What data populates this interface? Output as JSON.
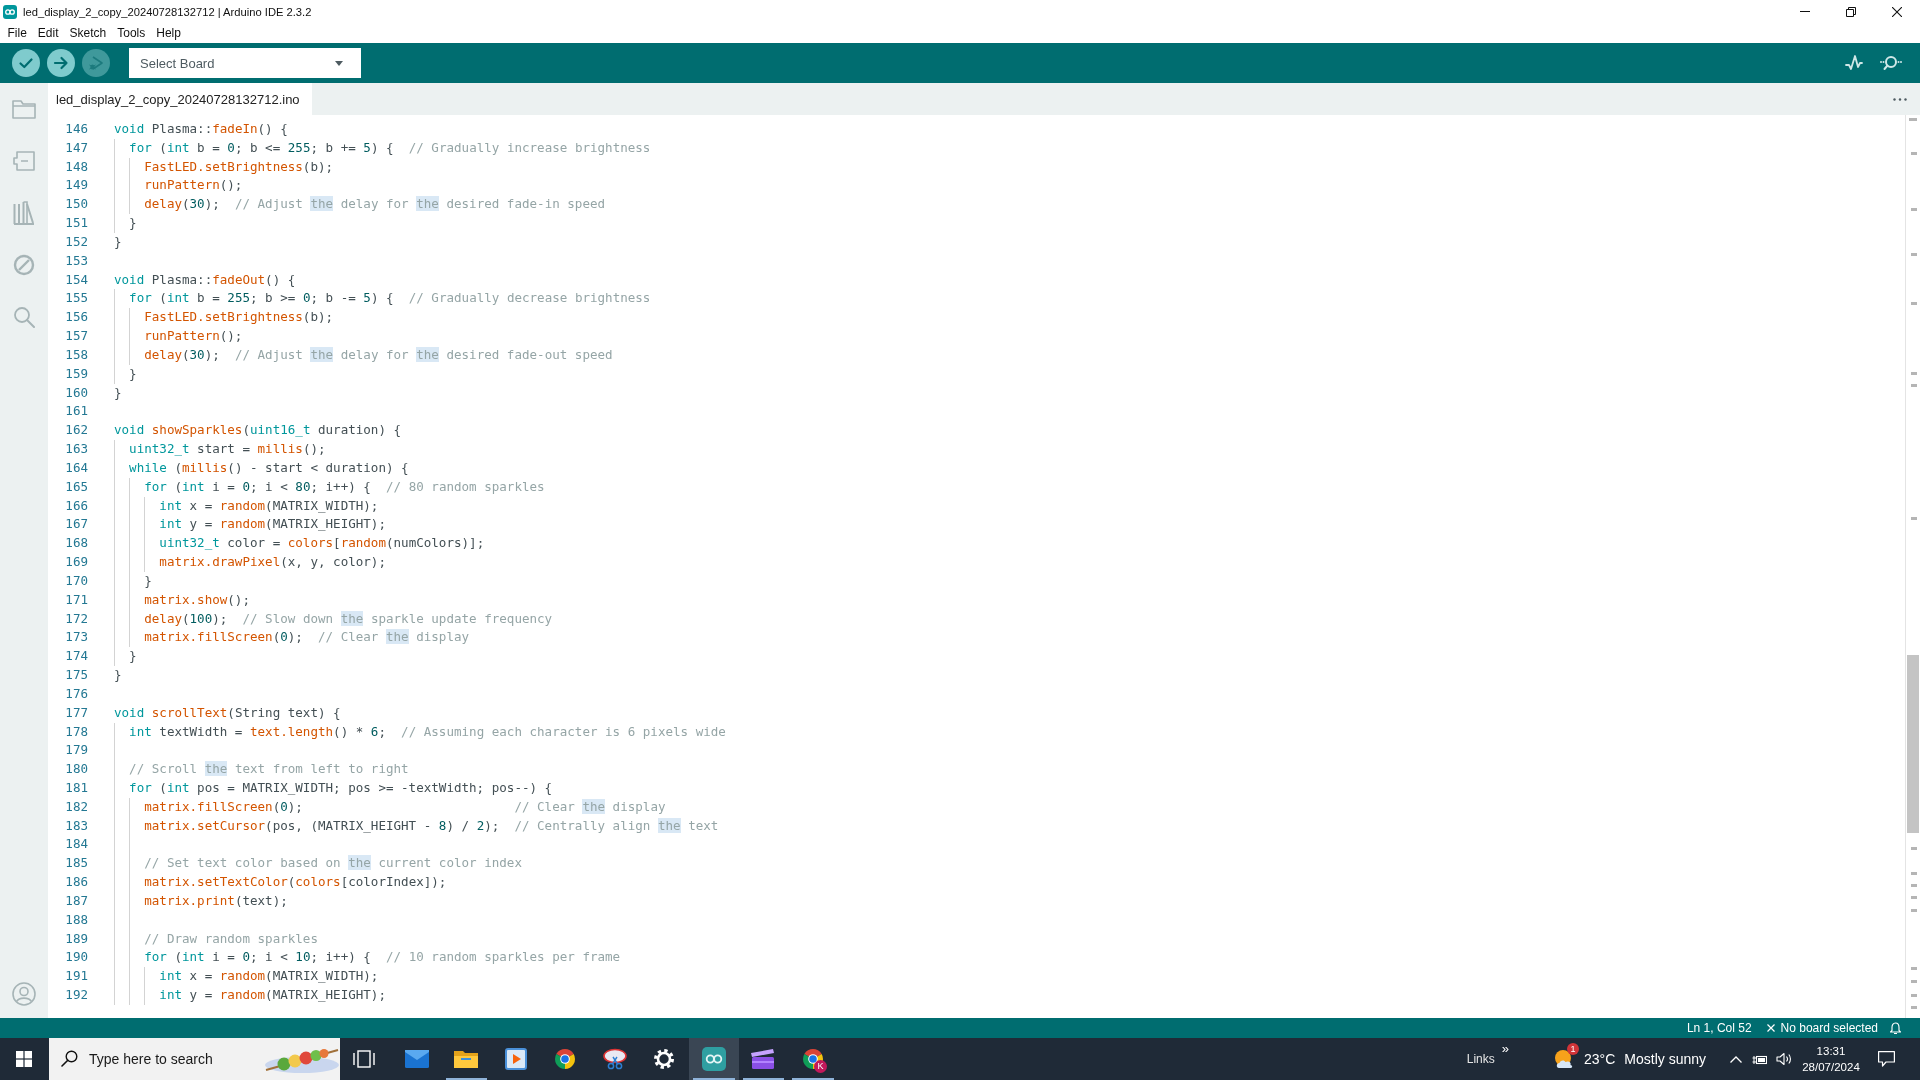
{
  "window": {
    "title": "led_display_2_copy_20240728132712 | Arduino IDE 2.3.2"
  },
  "menu": [
    "File",
    "Edit",
    "Sketch",
    "Tools",
    "Help"
  ],
  "toolbar": {
    "buttons": [
      {
        "kind": "verify",
        "disabled": false
      },
      {
        "kind": "upload",
        "disabled": false
      },
      {
        "kind": "debug",
        "disabled": true
      }
    ],
    "board_select": {
      "label": "Select Board"
    },
    "right_buttons": [
      {
        "kind": "plotter"
      },
      {
        "kind": "monitor"
      }
    ]
  },
  "sidebar": {
    "items": [
      {
        "kind": "sketchbook",
        "selected": false
      },
      {
        "kind": "boards",
        "selected": false
      },
      {
        "kind": "library",
        "selected": false
      },
      {
        "kind": "debug",
        "selected": false
      },
      {
        "kind": "search",
        "selected": false
      }
    ]
  },
  "tabs": [
    {
      "label": "led_display_2_copy_20240728132712.ino",
      "selected": true
    }
  ],
  "editor": {
    "lines": [
      {
        "number": "146",
        "tokens": [
          {
            "kind": "keyword",
            "text": "void"
          },
          {
            "kind": "plain",
            "text": " Plasma::"
          },
          {
            "kind": "function",
            "text": "fadeIn"
          },
          {
            "kind": "plain",
            "text": "() {"
          }
        ]
      },
      {
        "number": "147",
        "tokens": [
          {
            "kind": "keyword",
            "text": "  for"
          },
          {
            "kind": "plain",
            "text": " ("
          },
          {
            "kind": "keyword",
            "text": "int"
          },
          {
            "kind": "plain",
            "text": " b = "
          },
          {
            "kind": "number",
            "text": "0"
          },
          {
            "kind": "plain",
            "text": "; b <= "
          },
          {
            "kind": "number",
            "text": "255"
          },
          {
            "kind": "plain",
            "text": "; b += "
          },
          {
            "kind": "number",
            "text": "5"
          },
          {
            "kind": "plain",
            "text": ") {  "
          },
          {
            "kind": "comment",
            "text": "// Gradually increase brightness"
          }
        ]
      },
      {
        "number": "148",
        "tokens": [
          {
            "kind": "function",
            "text": "    FastLED.setBrightness"
          },
          {
            "kind": "plain",
            "text": "(b);"
          }
        ]
      },
      {
        "number": "149",
        "tokens": [
          {
            "kind": "function",
            "text": "    runPattern"
          },
          {
            "kind": "plain",
            "text": "();"
          }
        ]
      },
      {
        "number": "150",
        "tokens": [
          {
            "kind": "function",
            "text": "    delay"
          },
          {
            "kind": "plain",
            "text": "("
          },
          {
            "kind": "number",
            "text": "30"
          },
          {
            "kind": "plain",
            "text": ");  "
          },
          {
            "kind": "comment",
            "text": "// Adjust "
          },
          {
            "kind": "match",
            "text": "the"
          },
          {
            "kind": "comment",
            "text": " delay for "
          },
          {
            "kind": "match",
            "text": "the"
          },
          {
            "kind": "comment",
            "text": " desired fade-in speed"
          }
        ]
      },
      {
        "number": "151",
        "tokens": [
          {
            "kind": "plain",
            "text": "  }"
          }
        ]
      },
      {
        "number": "152",
        "tokens": [
          {
            "kind": "plain",
            "text": "}"
          }
        ]
      },
      {
        "number": "153"
      },
      {
        "number": "154",
        "tokens": [
          {
            "kind": "keyword",
            "text": "void"
          },
          {
            "kind": "plain",
            "text": " Plasma::"
          },
          {
            "kind": "function",
            "text": "fadeOut"
          },
          {
            "kind": "plain",
            "text": "() {"
          }
        ]
      },
      {
        "number": "155",
        "tokens": [
          {
            "kind": "keyword",
            "text": "  for"
          },
          {
            "kind": "plain",
            "text": " ("
          },
          {
            "kind": "keyword",
            "text": "int"
          },
          {
            "kind": "plain",
            "text": " b = "
          },
          {
            "kind": "number",
            "text": "255"
          },
          {
            "kind": "plain",
            "text": "; b >= "
          },
          {
            "kind": "number",
            "text": "0"
          },
          {
            "kind": "plain",
            "text": "; b -= "
          },
          {
            "kind": "number",
            "text": "5"
          },
          {
            "kind": "plain",
            "text": ") {  "
          },
          {
            "kind": "comment",
            "text": "// Gradually decrease brightness"
          }
        ]
      },
      {
        "number": "156",
        "tokens": [
          {
            "kind": "function",
            "text": "    FastLED.setBrightness"
          },
          {
            "kind": "plain",
            "text": "(b);"
          }
        ]
      },
      {
        "number": "157",
        "tokens": [
          {
            "kind": "function",
            "text": "    runPattern"
          },
          {
            "kind": "plain",
            "text": "();"
          }
        ]
      },
      {
        "number": "158",
        "tokens": [
          {
            "kind": "function",
            "text": "    delay"
          },
          {
            "kind": "plain",
            "text": "("
          },
          {
            "kind": "number",
            "text": "30"
          },
          {
            "kind": "plain",
            "text": ");  "
          },
          {
            "kind": "comment",
            "text": "// Adjust "
          },
          {
            "kind": "match",
            "text": "the"
          },
          {
            "kind": "comment",
            "text": " delay for "
          },
          {
            "kind": "match",
            "text": "the"
          },
          {
            "kind": "comment",
            "text": " desired fade-out speed"
          }
        ]
      },
      {
        "number": "159",
        "tokens": [
          {
            "kind": "plain",
            "text": "  }"
          }
        ]
      },
      {
        "number": "160",
        "tokens": [
          {
            "kind": "plain",
            "text": "}"
          }
        ]
      },
      {
        "number": "161"
      },
      {
        "number": "162",
        "tokens": [
          {
            "kind": "keyword",
            "text": "void "
          },
          {
            "kind": "function",
            "text": "showSparkles"
          },
          {
            "kind": "plain",
            "text": "("
          },
          {
            "kind": "keyword",
            "text": "uint16_t"
          },
          {
            "kind": "plain",
            "text": " duration) {"
          }
        ]
      },
      {
        "number": "163",
        "tokens": [
          {
            "kind": "keyword",
            "text": "  uint32_t"
          },
          {
            "kind": "plain",
            "text": " start = "
          },
          {
            "kind": "function",
            "text": "millis"
          },
          {
            "kind": "plain",
            "text": "();"
          }
        ]
      },
      {
        "number": "164",
        "tokens": [
          {
            "kind": "keyword",
            "text": "  while"
          },
          {
            "kind": "plain",
            "text": " ("
          },
          {
            "kind": "function",
            "text": "millis"
          },
          {
            "kind": "plain",
            "text": "() - start < duration) {"
          }
        ]
      },
      {
        "number": "165",
        "tokens": [
          {
            "kind": "keyword",
            "text": "    for"
          },
          {
            "kind": "plain",
            "text": " ("
          },
          {
            "kind": "keyword",
            "text": "int"
          },
          {
            "kind": "plain",
            "text": " i = "
          },
          {
            "kind": "number",
            "text": "0"
          },
          {
            "kind": "plain",
            "text": "; i < "
          },
          {
            "kind": "number",
            "text": "80"
          },
          {
            "kind": "plain",
            "text": "; i++) {  "
          },
          {
            "kind": "comment",
            "text": "// 80 random sparkles"
          }
        ]
      },
      {
        "number": "166",
        "tokens": [
          {
            "kind": "keyword",
            "text": "      int"
          },
          {
            "kind": "plain",
            "text": " x = "
          },
          {
            "kind": "function",
            "text": "random"
          },
          {
            "kind": "plain",
            "text": "(MATRIX_WIDTH);"
          }
        ]
      },
      {
        "number": "167",
        "tokens": [
          {
            "kind": "keyword",
            "text": "      int"
          },
          {
            "kind": "plain",
            "text": " y = "
          },
          {
            "kind": "function",
            "text": "random"
          },
          {
            "kind": "plain",
            "text": "(MATRIX_HEIGHT);"
          }
        ]
      },
      {
        "number": "168",
        "tokens": [
          {
            "kind": "keyword",
            "text": "      uint32_t"
          },
          {
            "kind": "plain",
            "text": " color = "
          },
          {
            "kind": "function",
            "text": "colors"
          },
          {
            "kind": "plain",
            "text": "["
          },
          {
            "kind": "function",
            "text": "random"
          },
          {
            "kind": "plain",
            "text": "(numColors)];"
          }
        ]
      },
      {
        "number": "169",
        "tokens": [
          {
            "kind": "function",
            "text": "      matrix.drawPixel"
          },
          {
            "kind": "plain",
            "text": "(x, y, color);"
          }
        ]
      },
      {
        "number": "170",
        "tokens": [
          {
            "kind": "plain",
            "text": "    }"
          }
        ]
      },
      {
        "number": "171",
        "tokens": [
          {
            "kind": "function",
            "text": "    matrix.show"
          },
          {
            "kind": "plain",
            "text": "();"
          }
        ]
      },
      {
        "number": "172",
        "tokens": [
          {
            "kind": "function",
            "text": "    delay"
          },
          {
            "kind": "plain",
            "text": "("
          },
          {
            "kind": "number",
            "text": "100"
          },
          {
            "kind": "plain",
            "text": ");  "
          },
          {
            "kind": "comment",
            "text": "// Slow down "
          },
          {
            "kind": "match",
            "text": "the"
          },
          {
            "kind": "comment",
            "text": " sparkle update frequency"
          }
        ]
      },
      {
        "number": "173",
        "tokens": [
          {
            "kind": "function",
            "text": "    matrix.fillScreen"
          },
          {
            "kind": "plain",
            "text": "("
          },
          {
            "kind": "number",
            "text": "0"
          },
          {
            "kind": "plain",
            "text": ");  "
          },
          {
            "kind": "comment",
            "text": "// Clear "
          },
          {
            "kind": "match",
            "text": "the"
          },
          {
            "kind": "comment",
            "text": " display"
          }
        ]
      },
      {
        "number": "174",
        "tokens": [
          {
            "kind": "plain",
            "text": "  }"
          }
        ]
      },
      {
        "number": "175",
        "tokens": [
          {
            "kind": "plain",
            "text": "}"
          }
        ]
      },
      {
        "number": "176"
      },
      {
        "number": "177",
        "tokens": [
          {
            "kind": "keyword",
            "text": "void "
          },
          {
            "kind": "function",
            "text": "scrollText"
          },
          {
            "kind": "plain",
            "text": "(String text) {"
          }
        ]
      },
      {
        "number": "178",
        "tokens": [
          {
            "kind": "keyword",
            "text": "  int"
          },
          {
            "kind": "plain",
            "text": " textWidth = "
          },
          {
            "kind": "function",
            "text": "text.length"
          },
          {
            "kind": "plain",
            "text": "() * "
          },
          {
            "kind": "number",
            "text": "6"
          },
          {
            "kind": "plain",
            "text": ";  "
          },
          {
            "kind": "comment",
            "text": "// Assuming each character is 6 pixels wide"
          }
        ]
      },
      {
        "number": "179"
      },
      {
        "number": "180",
        "tokens": [
          {
            "kind": "comment",
            "text": "  // Scroll "
          },
          {
            "kind": "match",
            "text": "the"
          },
          {
            "kind": "comment",
            "text": " text from left to right"
          }
        ]
      },
      {
        "number": "181",
        "tokens": [
          {
            "kind": "keyword",
            "text": "  for"
          },
          {
            "kind": "plain",
            "text": " ("
          },
          {
            "kind": "keyword",
            "text": "int"
          },
          {
            "kind": "plain",
            "text": " pos = MATRIX_WIDTH; pos >= -textWidth; pos--) {"
          }
        ]
      },
      {
        "number": "182",
        "tokens": [
          {
            "kind": "function",
            "text": "    matrix.fillScreen"
          },
          {
            "kind": "plain",
            "text": "("
          },
          {
            "kind": "number",
            "text": "0"
          },
          {
            "kind": "plain",
            "text": ");                            "
          },
          {
            "kind": "comment",
            "text": "// Clear "
          },
          {
            "kind": "match",
            "text": "the"
          },
          {
            "kind": "comment",
            "text": " display"
          }
        ]
      },
      {
        "number": "183",
        "tokens": [
          {
            "kind": "function",
            "text": "    matrix.setCursor"
          },
          {
            "kind": "plain",
            "text": "(pos, (MATRIX_HEIGHT - "
          },
          {
            "kind": "number",
            "text": "8"
          },
          {
            "kind": "plain",
            "text": ") / "
          },
          {
            "kind": "number",
            "text": "2"
          },
          {
            "kind": "plain",
            "text": ");  "
          },
          {
            "kind": "comment",
            "text": "// Centrally align "
          },
          {
            "kind": "match",
            "text": "the"
          },
          {
            "kind": "comment",
            "text": " text"
          }
        ]
      },
      {
        "number": "184"
      },
      {
        "number": "185",
        "tokens": [
          {
            "kind": "comment",
            "text": "    // Set text color based on "
          },
          {
            "kind": "match",
            "text": "the"
          },
          {
            "kind": "comment",
            "text": " current color index"
          }
        ]
      },
      {
        "number": "186",
        "tokens": [
          {
            "kind": "function",
            "text": "    matrix.setTextColor"
          },
          {
            "kind": "plain",
            "text": "("
          },
          {
            "kind": "function",
            "text": "colors"
          },
          {
            "kind": "plain",
            "text": "[colorIndex]);"
          }
        ]
      },
      {
        "number": "187",
        "tokens": [
          {
            "kind": "function",
            "text": "    matrix.print"
          },
          {
            "kind": "plain",
            "text": "(text);"
          }
        ]
      },
      {
        "number": "188"
      },
      {
        "number": "189",
        "tokens": [
          {
            "kind": "comment",
            "text": "    // Draw random sparkles"
          }
        ]
      },
      {
        "number": "190",
        "tokens": [
          {
            "kind": "keyword",
            "text": "    for"
          },
          {
            "kind": "plain",
            "text": " ("
          },
          {
            "kind": "keyword",
            "text": "int"
          },
          {
            "kind": "plain",
            "text": " i = "
          },
          {
            "kind": "number",
            "text": "0"
          },
          {
            "kind": "plain",
            "text": "; i < "
          },
          {
            "kind": "number",
            "text": "10"
          },
          {
            "kind": "plain",
            "text": "; i++) {  "
          },
          {
            "kind": "comment",
            "text": "// 10 random sparkles per frame"
          }
        ]
      },
      {
        "number": "191",
        "tokens": [
          {
            "kind": "keyword",
            "text": "      int"
          },
          {
            "kind": "plain",
            "text": " x = "
          },
          {
            "kind": "function",
            "text": "random"
          },
          {
            "kind": "plain",
            "text": "(MATRIX_WIDTH);"
          }
        ]
      },
      {
        "number": "192",
        "tokens": [
          {
            "kind": "keyword",
            "text": "      int"
          },
          {
            "kind": "plain",
            "text": " y = "
          },
          {
            "kind": "function",
            "text": "random"
          },
          {
            "kind": "plain",
            "text": "(MATRIX_HEIGHT);"
          }
        ]
      }
    ]
  },
  "status_bar": {
    "position": "Ln 1, Col 52",
    "board": "No board selected"
  },
  "taskbar": {
    "search": {
      "placeholder": "Type here to search"
    },
    "apps": [
      {
        "kind": "task-view"
      },
      {
        "kind": "mail",
        "running": false,
        "selected": false
      },
      {
        "kind": "files",
        "running": true,
        "selected": false
      },
      {
        "kind": "media",
        "running": false,
        "selected": false
      },
      {
        "kind": "browser",
        "running": false,
        "selected": false
      },
      {
        "kind": "snip",
        "running": false,
        "selected": false
      },
      {
        "kind": "settings",
        "running": false,
        "selected": false
      },
      {
        "kind": "ide",
        "running": true,
        "selected": true
      },
      {
        "kind": "video",
        "running": true,
        "selected": false
      },
      {
        "kind": "browser",
        "running": true,
        "selected": false,
        "badge": "K"
      }
    ],
    "links": {
      "label": "Links",
      "more": "»"
    },
    "weather": {
      "badge": "1",
      "temperature": "23°C",
      "condition": "Mostly sunny"
    },
    "clock": {
      "time": "13:31",
      "date": "28/07/2024"
    }
  }
}
